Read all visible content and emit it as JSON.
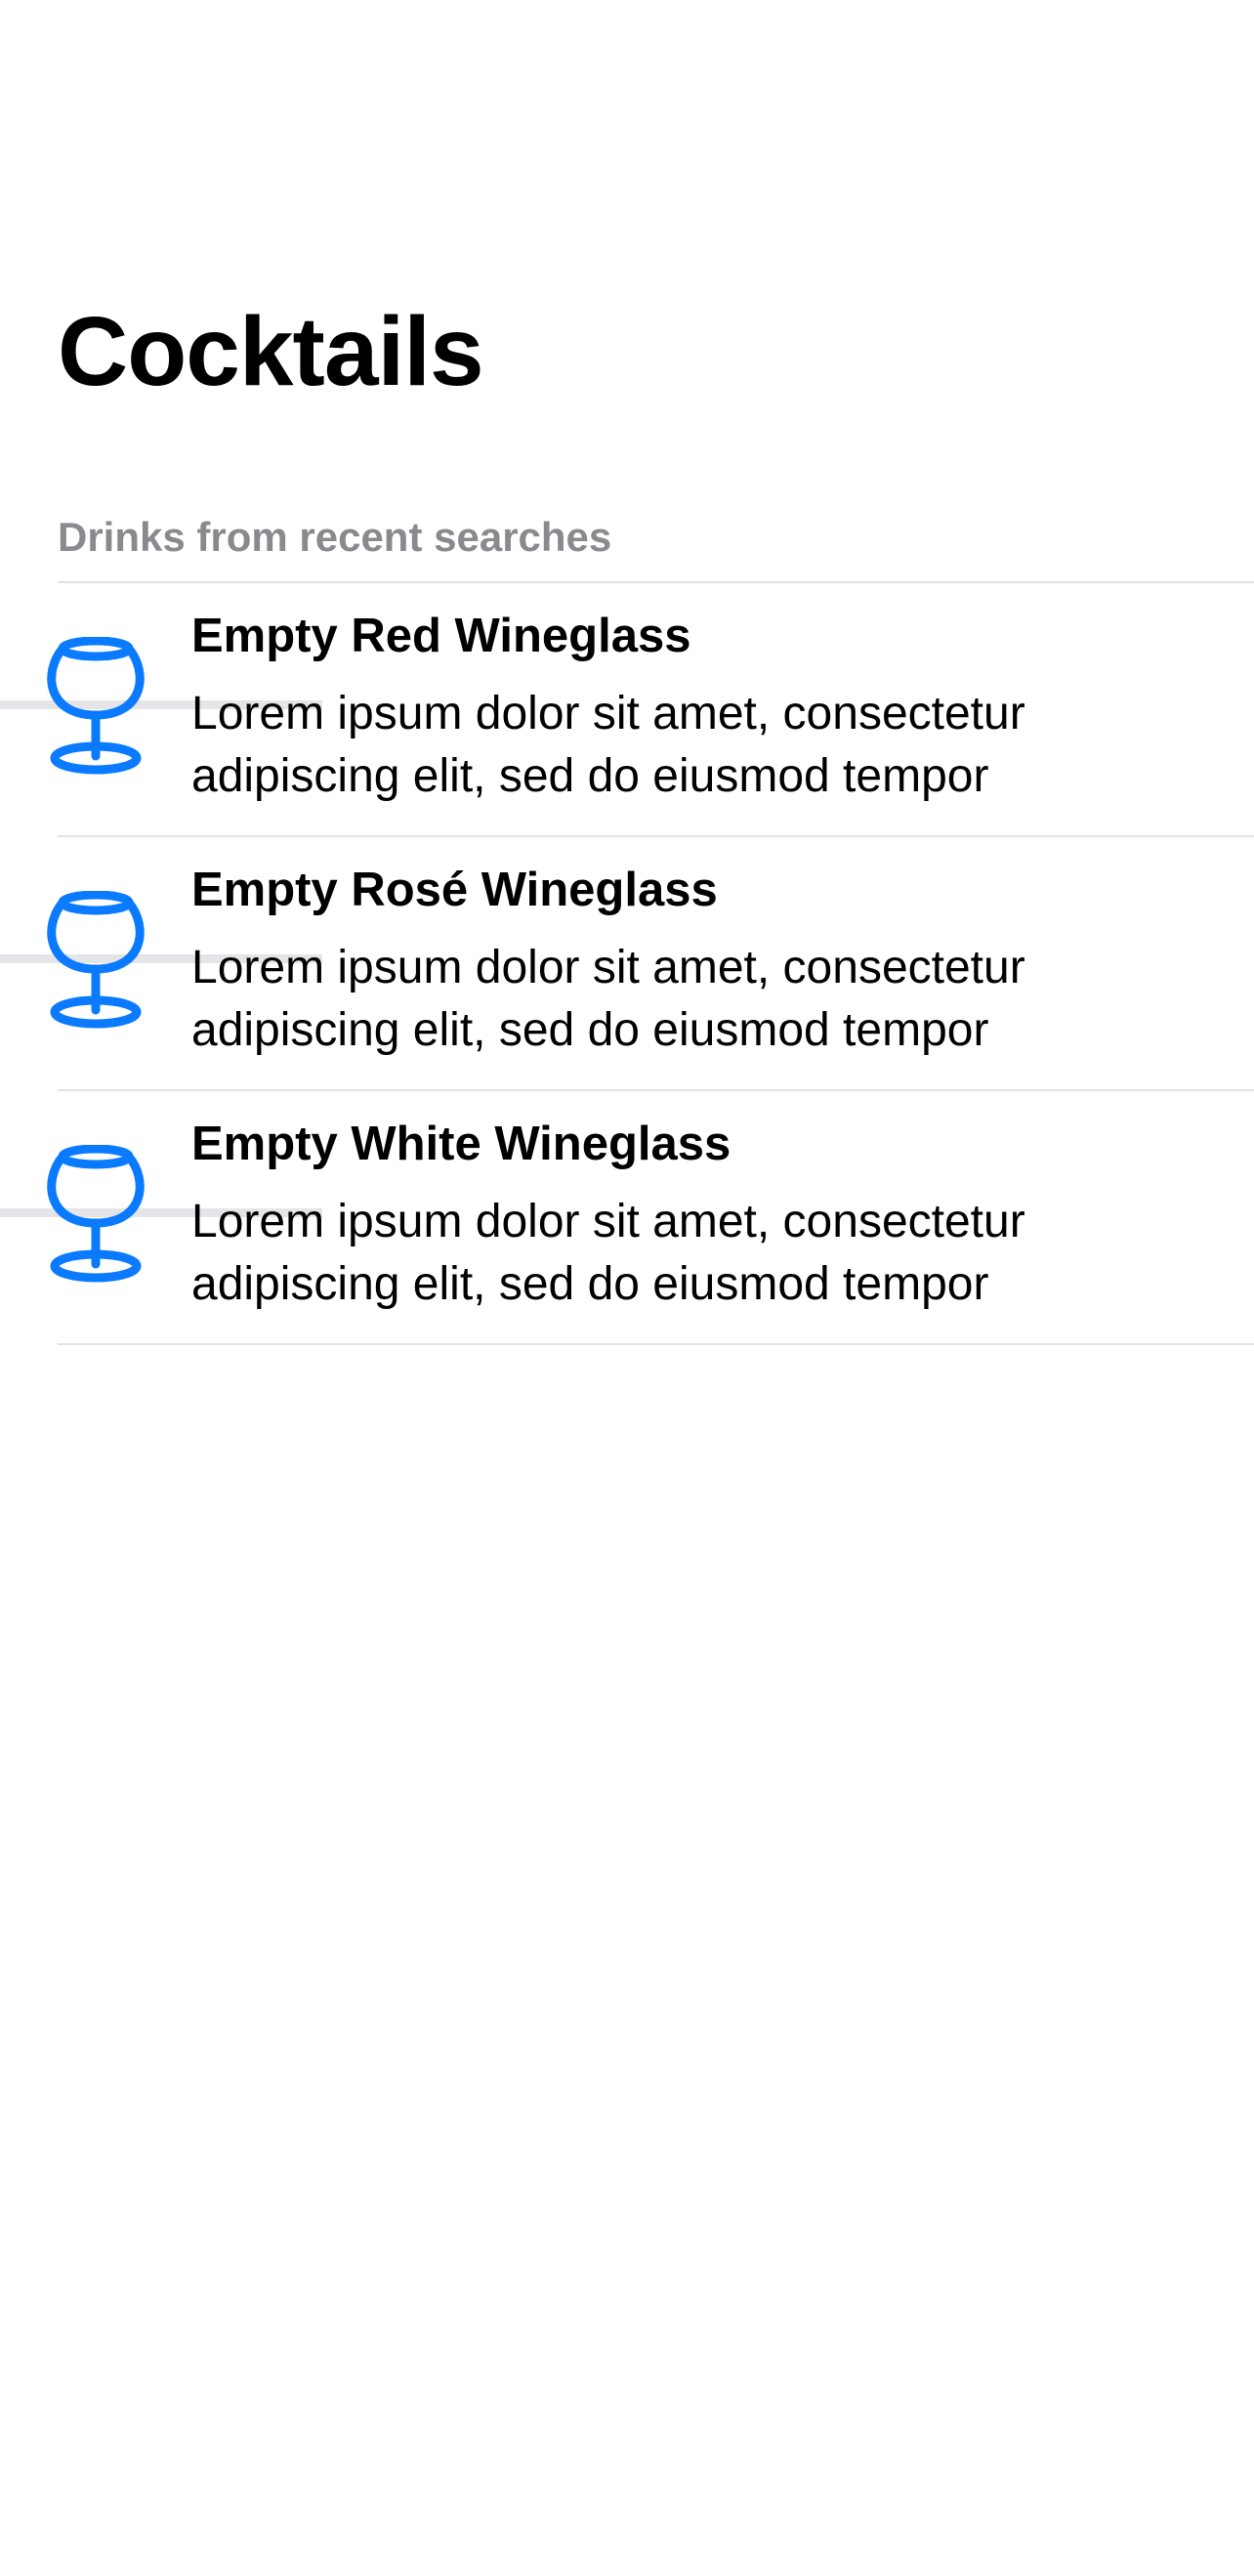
{
  "header": {
    "title": "Cocktails"
  },
  "section": {
    "header": "Drinks from recent searches"
  },
  "items": [
    {
      "title": "Empty Red Wineglass",
      "subtitle": "Lorem ipsum dolor sit amet, consectetur adipiscing elit, sed do eiusmod tempor",
      "icon": "wineglass-icon"
    },
    {
      "title": "Empty Rosé Wineglass",
      "subtitle": "Lorem ipsum dolor sit amet, consectetur adipiscing elit, sed do eiusmod tempor",
      "icon": "wineglass-icon"
    },
    {
      "title": "Empty White Wineglass",
      "subtitle": "Lorem ipsum dolor sit amet, consectetur adipiscing elit, sed do eiusmod tempor",
      "icon": "wineglass-icon"
    }
  ],
  "colors": {
    "accent": "#0a7aff",
    "section_header": "#8a8a8e",
    "separator": "#e3e3e6",
    "background": "#ffffff"
  }
}
